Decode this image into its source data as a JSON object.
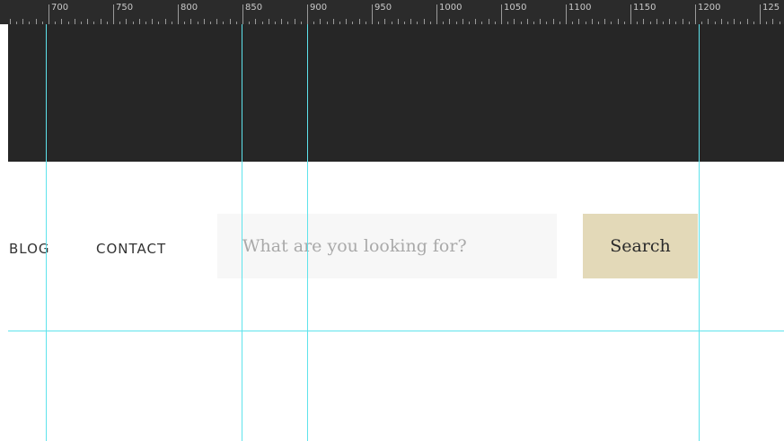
{
  "ruler": {
    "labels": [
      "700",
      "750",
      "800",
      "850",
      "900",
      "950",
      "1000",
      "1050",
      "1100",
      "1150",
      "1200",
      "125"
    ]
  },
  "nav": {
    "blog": "BLOG",
    "contact": "CONTACT"
  },
  "search": {
    "placeholder": "What are you looking for?",
    "button_label": "Search"
  },
  "colors": {
    "banner": "#262626",
    "search_button": "#e3d9b8",
    "guide": "#5ee3ec"
  }
}
